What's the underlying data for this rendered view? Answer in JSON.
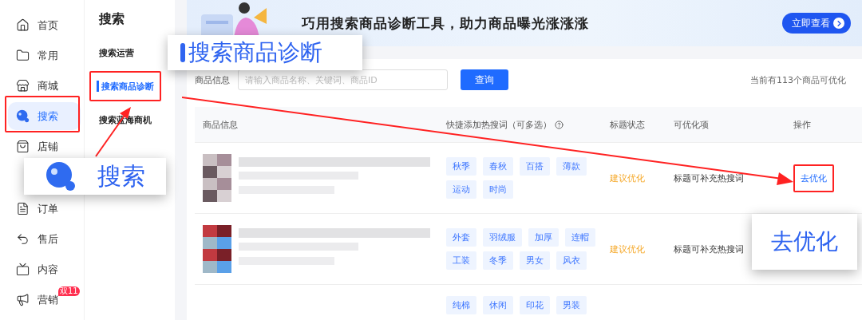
{
  "nav": {
    "items": [
      {
        "label": "首页",
        "selected": false
      },
      {
        "label": "常用",
        "selected": false
      },
      {
        "label": "商城",
        "selected": false
      },
      {
        "label": "搜索",
        "selected": true
      },
      {
        "label": "店铺",
        "selected": false
      },
      {
        "label": "订单",
        "selected": false
      },
      {
        "label": "售后",
        "selected": false
      },
      {
        "label": "内容",
        "selected": false
      },
      {
        "label": "营销",
        "selected": false,
        "badge": "双11"
      }
    ]
  },
  "submenu": {
    "title": "搜索",
    "items": [
      {
        "label": "搜索运营",
        "selected": false
      },
      {
        "label": "搜索商品诊断",
        "selected": true
      },
      {
        "label": "搜索蓝海商机",
        "selected": false
      }
    ]
  },
  "banner": {
    "text": "巧用搜索商品诊断工具，助力商品曝光涨涨涨",
    "button": "立即查看"
  },
  "search": {
    "label": "商品信息",
    "placeholder": "请输入商品名称、关键词、商品ID",
    "button": "查询",
    "summary": "当前有113个商品可优化"
  },
  "table": {
    "columns": [
      "商品信息",
      "快捷添加热搜词（可多选）",
      "标题状态",
      "可优化项",
      "操作"
    ],
    "rows": [
      {
        "tags": [
          "秋季",
          "春秋",
          "百搭",
          "薄款",
          "运动",
          "时尚"
        ],
        "status": "建议优化",
        "item": "标题可补充热搜词",
        "action": "去优化",
        "highlighted": true
      },
      {
        "tags": [
          "外套",
          "羽绒服",
          "加厚",
          "连帽",
          "工装",
          "冬季",
          "男女",
          "风衣"
        ],
        "status": "建议优化",
        "item": "标题可补充热搜词"
      },
      {
        "tags": [
          "纯棉",
          "休闲",
          "印花",
          "男装"
        ]
      }
    ]
  },
  "callouts": [
    {
      "text": "搜索商品诊断"
    },
    {
      "text": "搜索"
    },
    {
      "text": "去优化"
    }
  ]
}
